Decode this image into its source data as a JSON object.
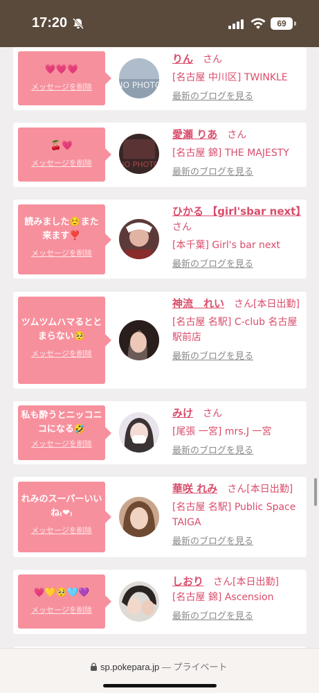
{
  "status_bar": {
    "time": "17:20",
    "battery": "69"
  },
  "colors": {
    "accent": "#d94c6a",
    "bubble": "#f7909d",
    "link_gray": "#8a8a8a",
    "status_bg": "#5a4a3b"
  },
  "san": "さん",
  "cards": [
    {
      "message": "💗💗💗",
      "delete_label": "メッセージを削除",
      "name": "りん",
      "name_suffix": "",
      "shop": "[名古屋 中川区] TWINKLE",
      "blog_label": "最新のブログを見る",
      "avatar": "no-photo"
    },
    {
      "message": "🍒💗",
      "delete_label": "メッセージを削除",
      "name": "愛瀬 りあ",
      "name_suffix": "",
      "shop": "[名古屋 錦] THE MAJESTY",
      "blog_label": "最新のブログを見る",
      "avatar": "no-photo-dark"
    },
    {
      "message": "読みました☺️また来ます❣️",
      "delete_label": "メッセージを削除",
      "name": "ひかる 【girl'sbar next】",
      "name_suffix": "",
      "shop": "[本千葉] Girl's bar next",
      "blog_label": "最新のブログを見る",
      "avatar": "photo"
    },
    {
      "message": "ツムツムハマるととまらない🥺",
      "delete_label": "メッセージを削除",
      "name": "神流　れい",
      "name_suffix": "[本日出勤]",
      "shop": "[名古屋 名駅] C-club 名古屋駅前店",
      "blog_label": "最新のブログを見る",
      "avatar": "photo"
    },
    {
      "message": "私も酔うとニッコニコになる🤣",
      "delete_label": "メッセージを削除",
      "name": "みけ",
      "name_suffix": "",
      "shop": "[尾張 一宮] mrs.J 一宮",
      "blog_label": "最新のブログを見る",
      "avatar": "photo"
    },
    {
      "message": "れみのスーパーいいね₍❤︎₎",
      "delete_label": "メッセージを削除",
      "name": "華咲 れみ",
      "name_suffix": "[本日出勤]",
      "shop": "[名古屋 名駅] Public Space TAIGA",
      "blog_label": "最新のブログを見る",
      "avatar": "photo"
    },
    {
      "message": "💗💛🥺🩵💜",
      "delete_label": "メッセージを削除",
      "name": "しおり",
      "name_suffix": "[本日出勤]",
      "shop": "[名古屋 錦] Ascension",
      "blog_label": "最新のブログを見る",
      "avatar": "photo"
    }
  ],
  "url_bar": {
    "url": "sp.pokepara.jp",
    "private": "— プライベート"
  }
}
